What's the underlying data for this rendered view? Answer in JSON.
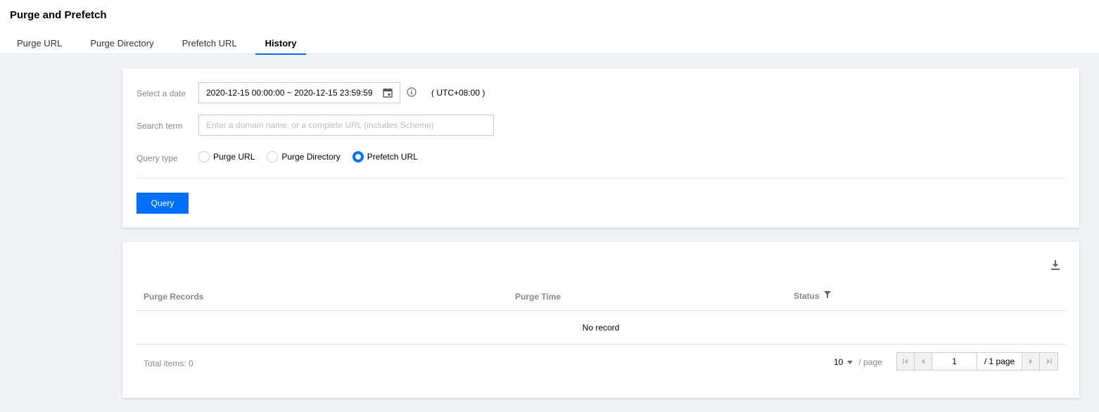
{
  "page": {
    "title": "Purge and Prefetch"
  },
  "tabs": [
    {
      "label": "Purge URL",
      "active": false
    },
    {
      "label": "Purge Directory",
      "active": false
    },
    {
      "label": "Prefetch URL",
      "active": false
    },
    {
      "label": "History",
      "active": true
    }
  ],
  "form": {
    "date_label": "Select a date",
    "date_value": "2020-12-15 00:00:00 ~ 2020-12-15 23:59:59",
    "timezone": "( UTC+08:00 )",
    "search_label": "Search term",
    "search_value": "",
    "search_placeholder": "Enter a domain name, or a complete URL (includes Scheme)",
    "query_type_label": "Query type",
    "query_types": [
      {
        "label": "Purge URL",
        "checked": false
      },
      {
        "label": "Purge Directory",
        "checked": false
      },
      {
        "label": "Prefetch URL",
        "checked": true
      }
    ],
    "query_button": "Query"
  },
  "table": {
    "columns": [
      "Purge Records",
      "Purge Time",
      "Status"
    ],
    "empty_text": "No record"
  },
  "pagination": {
    "total": "Total items:  0",
    "page_size": "10",
    "per_page": "/ page",
    "current_page": "1",
    "page_total": "/ 1 page"
  },
  "colors": {
    "accent": "#006eff",
    "background": "#f2f3f7"
  }
}
